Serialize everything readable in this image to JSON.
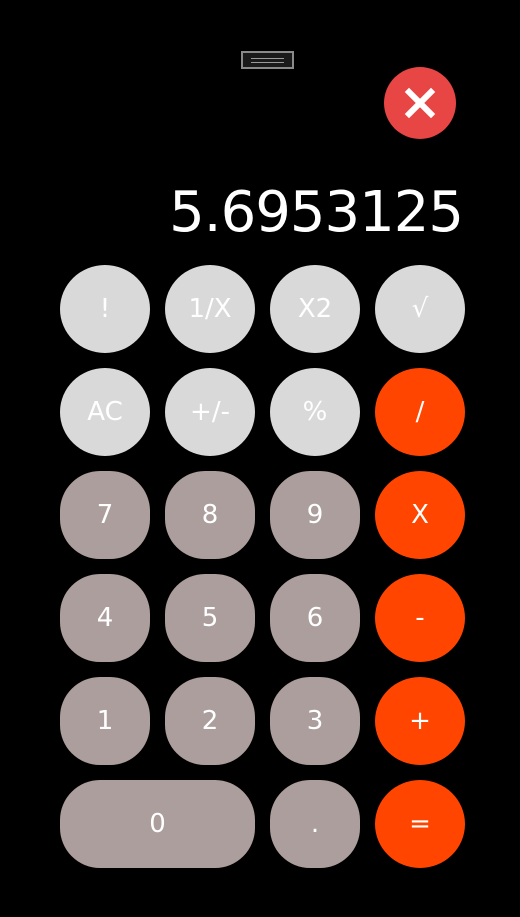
{
  "display": {
    "value": "5.6953125"
  },
  "icons": {
    "drag_handle": "drag-handle-icon",
    "close": "close-icon"
  },
  "colors": {
    "background": "#000000",
    "function_key": "#d9d9d9",
    "number_key": "#ab9e9c",
    "operator_key": "#ff4500",
    "close_button": "#e84545",
    "text": "#ffffff"
  },
  "keys": {
    "factorial": "!",
    "reciprocal": "1/X",
    "square": "X2",
    "sqrt": "√",
    "clear": "AC",
    "negate": "+/-",
    "percent": "%",
    "divide": "/",
    "seven": "7",
    "eight": "8",
    "nine": "9",
    "multiply": "X",
    "four": "4",
    "five": "5",
    "six": "6",
    "subtract": "-",
    "one": "1",
    "two": "2",
    "three": "3",
    "add": "+",
    "zero": "0",
    "decimal": ".",
    "equals": "="
  }
}
